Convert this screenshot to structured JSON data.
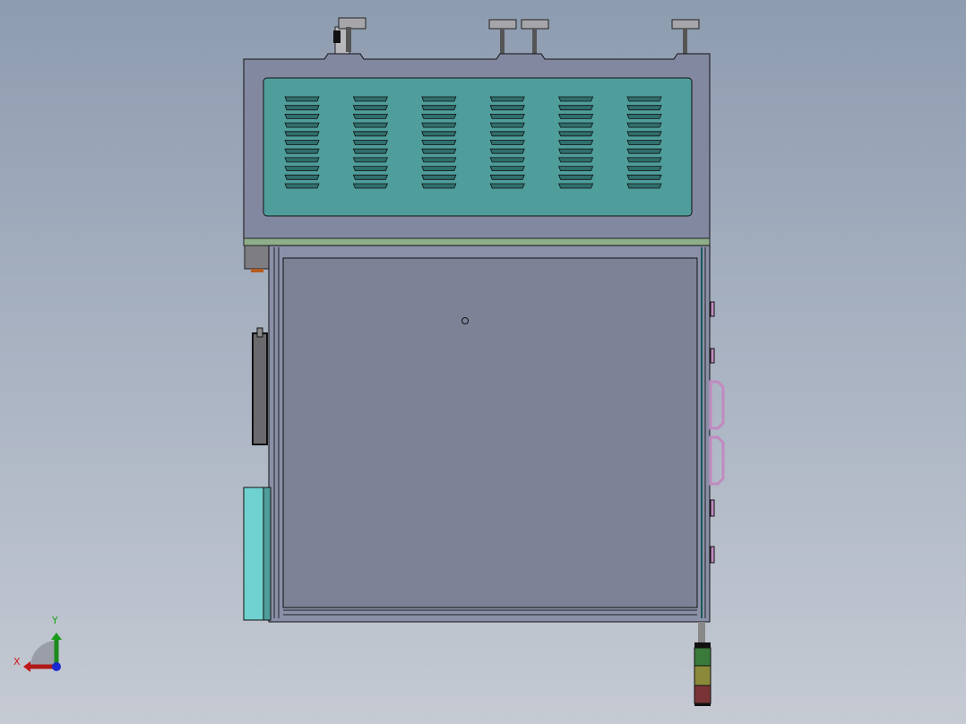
{
  "viewport": {
    "background_top": "#8e9cb0",
    "background_bottom": "#c5cad3",
    "louver_columns": 6,
    "louver_rows": 11
  },
  "colors": {
    "panel_teal": "#4f9e9c",
    "louver": "#2f6e6c",
    "frame_gray": "#8288a0",
    "chamber": "#7e8296",
    "strip_green": "#8fae8a",
    "tank_cyan": "#6fd2d0",
    "handle_pink": "#c08ac0",
    "light_green": "#3a7a3a",
    "light_yellow": "#8a8a3a",
    "light_red": "#7a3438"
  },
  "triad": {
    "x_label": "X",
    "y_label": "Y"
  }
}
